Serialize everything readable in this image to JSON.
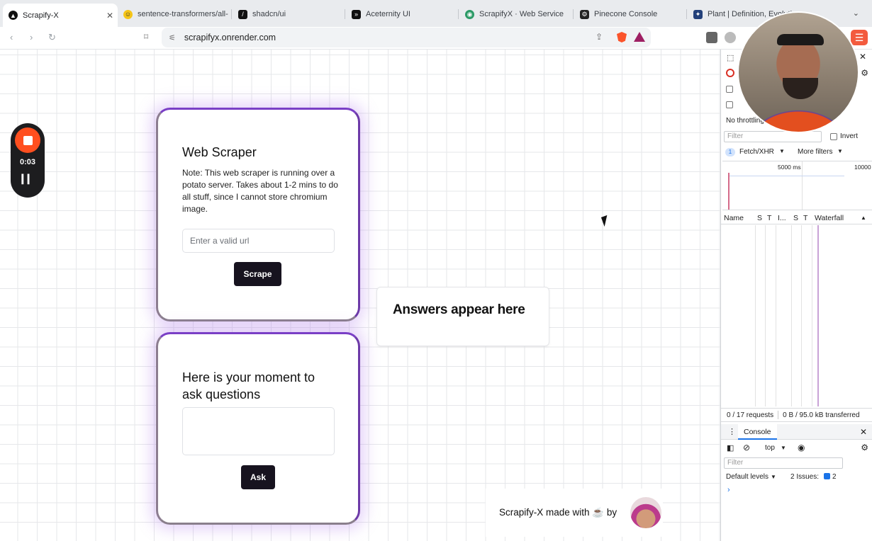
{
  "browser": {
    "tabs": [
      {
        "label": "Scrapify-X",
        "active": true
      },
      {
        "label": "sentence-transformers/all-"
      },
      {
        "label": "shadcn/ui"
      },
      {
        "label": "Aceternity UI"
      },
      {
        "label": "ScrapifyX · Web Service"
      },
      {
        "label": "Pinecone Console"
      },
      {
        "label": "Plant | Definition, Evolution"
      }
    ],
    "url": "scrapifyx.onrender.com"
  },
  "recorder": {
    "time": "0:03"
  },
  "scraper": {
    "title": "Web Scraper",
    "note": "Note: This web scraper is running over a potato server. Takes about 1-2 mins to do all stuff, since I cannot store chromium image.",
    "url_placeholder": "Enter a valid url",
    "button": "Scrape"
  },
  "ask": {
    "title": "Here is your moment to ask questions",
    "button": "Ask"
  },
  "answers": {
    "label": "Answers appear here"
  },
  "footer": {
    "text": "Scrapify-X made with ☕ by"
  },
  "devtools": {
    "no_throttling": "No throttling",
    "filter_placeholder": "Filter",
    "invert": "Invert",
    "fetch_badge": "1",
    "fetch_xhr": "Fetch/XHR",
    "more_filters": "More filters",
    "tick_5000": "5000 ms",
    "tick_10000": "10000",
    "columns": [
      "Name",
      "S",
      "T",
      "I...",
      "S",
      "T",
      "Waterfall"
    ],
    "requests": "0 / 17 requests",
    "transferred": "0 B / 95.0 kB transferred",
    "console_tab": "Console",
    "context": "top",
    "console_filter": "Filter",
    "default_levels": "Default levels",
    "issues_label": "2 Issues:",
    "issues_count": "2"
  },
  "colors": {
    "card_border": "#7b3fc6",
    "button_bg": "#17131f",
    "record_red": "#ff4f1f",
    "accent_blue": "#1a73e8"
  }
}
